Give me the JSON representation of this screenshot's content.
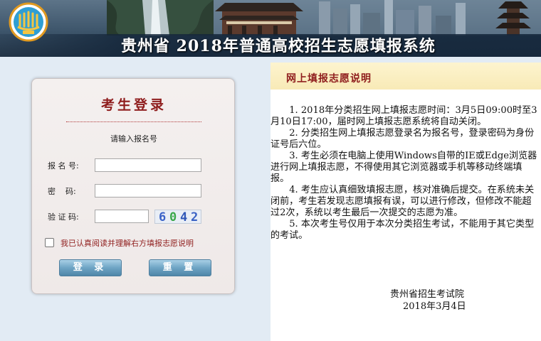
{
  "header": {
    "title": "贵州省 2018年普通高校招生志愿填报系统",
    "logo_icon": "guizhou-exam-logo-icon"
  },
  "login": {
    "title": "考生登录",
    "hint": "请输入报名号",
    "fields": {
      "exam_number_label": "报 名 号:",
      "password_label": "密    码:",
      "captcha_label": "验 证 码:"
    },
    "captcha_text": [
      "6",
      "0",
      "4",
      "2"
    ],
    "agree_text": "我已认真阅读并理解右方填报志愿说明",
    "login_button": "登 录",
    "reset_button": "重 置"
  },
  "notice": {
    "title": "网上填报志愿说明",
    "paragraphs": [
      "1. 2018年分类招生网上填报志愿时间：3月5日09:00时至3月10日17:00，届时网上填报志愿系统将自动关闭。",
      "2. 分类招生网上填报志愿登录名为报名号，登录密码为身份证号后六位。",
      "3. 考生必须在电脑上使用Windows自带的IE或Edge浏览器进行网上填报志愿，不得使用其它浏览器或手机等移动终端填报。",
      "4. 考生应认真细致填报志愿，核对准确后提交。在系统未关闭前，考生若发现志愿填报有误，可以进行修改，但修改不能超过2次，系统以考生最后一次提交的志愿为准。",
      "5. 本次考生号仅用于本次分类招生考试，不能用于其它类型的考试。"
    ],
    "signature": "贵州省招生考试院",
    "date": "2018年3月4日"
  },
  "colors": {
    "accent_red": "#8f1d1d",
    "button_blue": "#6ea4c4",
    "page_bg": "#e2ebf4",
    "notice_head": "#f8eab6"
  }
}
